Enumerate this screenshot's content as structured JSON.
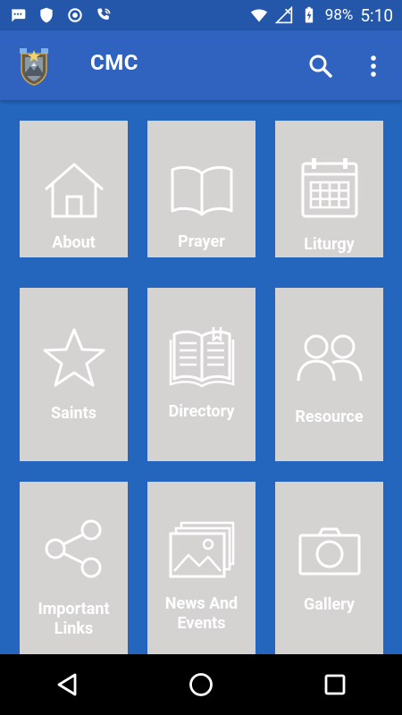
{
  "status_bar": {
    "battery": "98%",
    "time": "5:10",
    "icons": [
      "chat-icon",
      "shield-icon",
      "target-icon",
      "wifi-call-icon",
      "wifi-icon",
      "signal-off-icon",
      "battery-charging-icon"
    ]
  },
  "app_bar": {
    "title": "CMC",
    "icons": [
      "logo-icon",
      "search-icon",
      "more-vert-icon"
    ]
  },
  "tiles": [
    {
      "label": "About",
      "icon": "home-icon"
    },
    {
      "label": "Prayer",
      "icon": "open-book-icon"
    },
    {
      "label": "Liturgy",
      "icon": "calendar-icon"
    },
    {
      "label": "Saints",
      "icon": "star-icon"
    },
    {
      "label": "Directory",
      "icon": "book-lines-icon"
    },
    {
      "label": "Resource",
      "icon": "people-icon"
    },
    {
      "label": "Important\nLinks",
      "icon": "share-icon"
    },
    {
      "label": "News And\nEvents",
      "icon": "images-icon"
    },
    {
      "label": "Gallery",
      "icon": "camera-icon"
    }
  ],
  "nav_bar": {
    "icons": [
      "back-icon",
      "home-circle-icon",
      "recents-icon"
    ]
  },
  "colors": {
    "background": "#2466be",
    "app_bar": "#2f63bf",
    "status_bar": "#2457aa",
    "tile": "#d5d3d2",
    "nav_bar": "#000000"
  }
}
